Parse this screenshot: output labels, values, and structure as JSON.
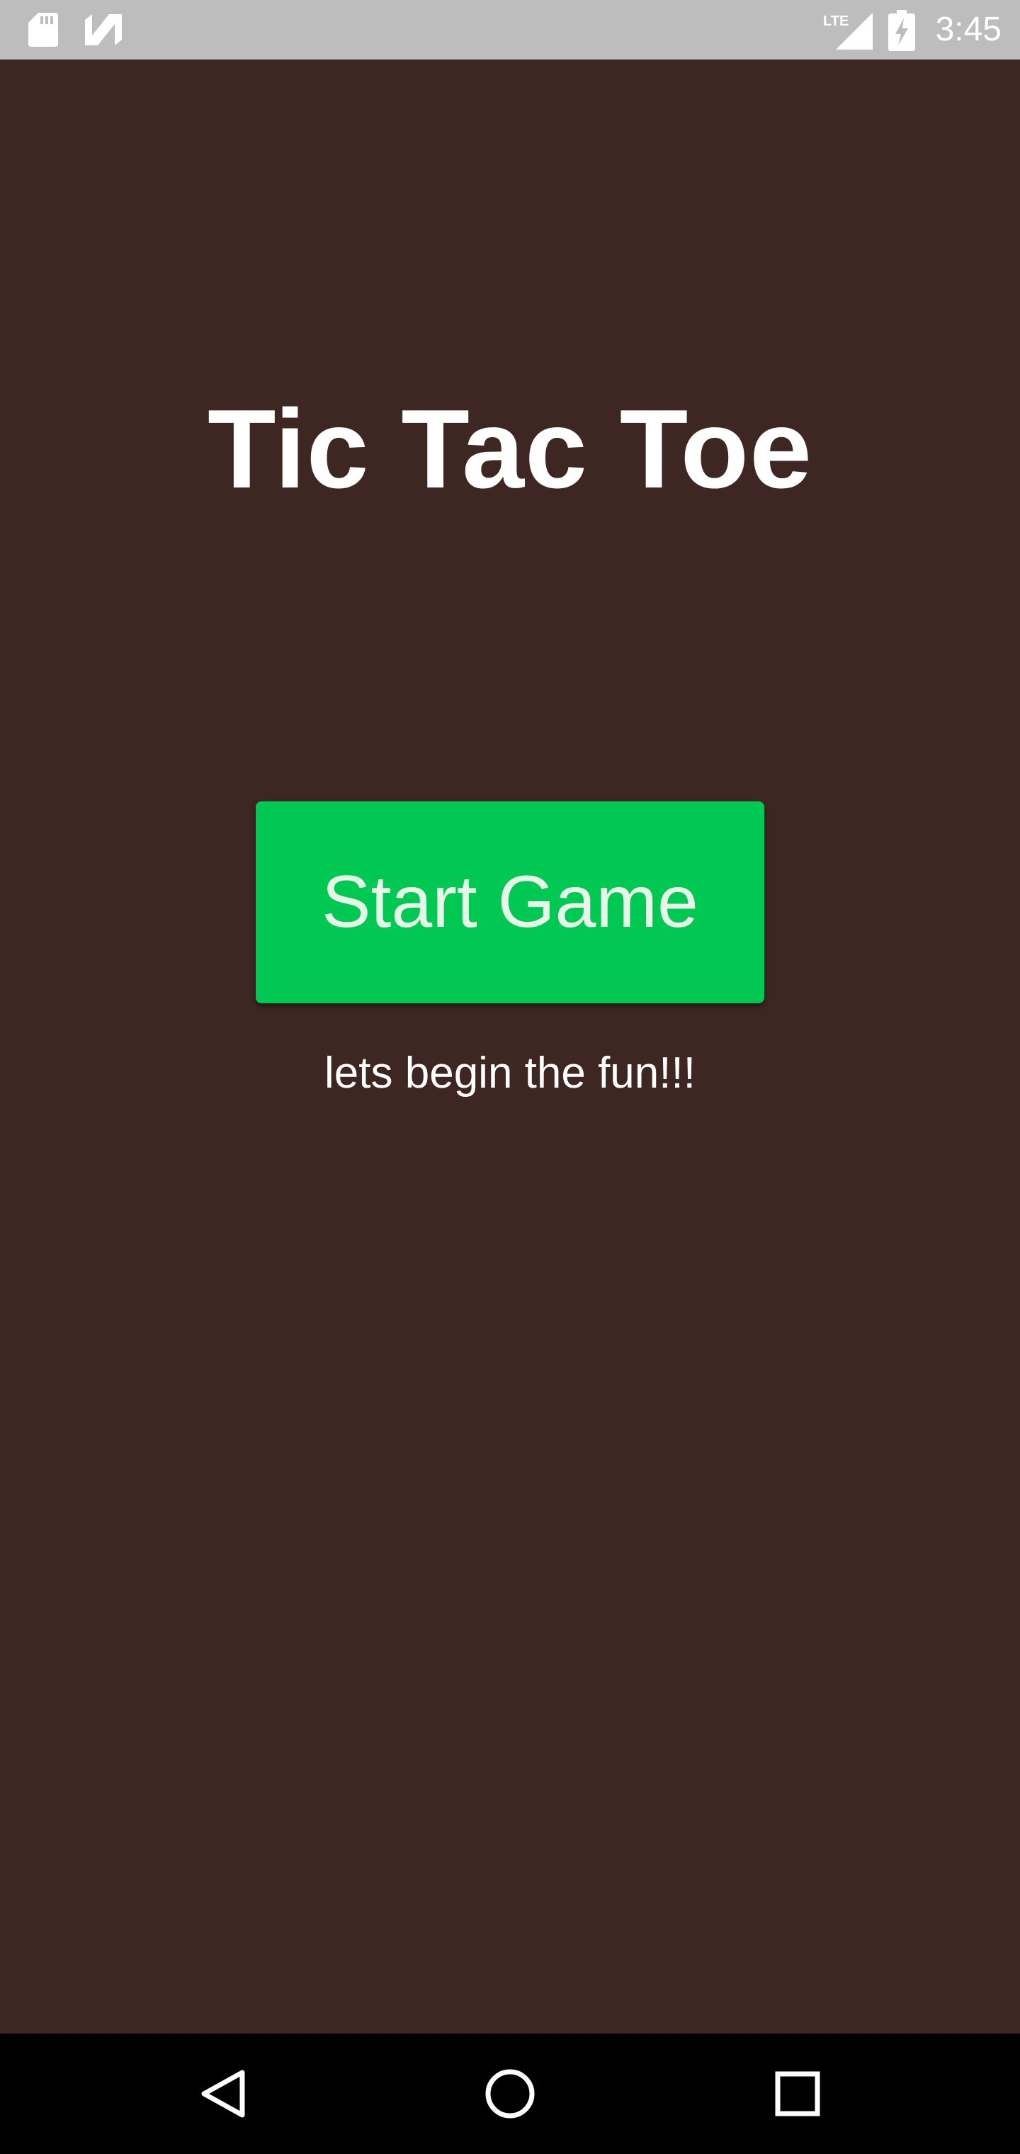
{
  "status_bar": {
    "time": "3:45",
    "left_icons": [
      "sd-card-icon",
      "n-logo-icon"
    ],
    "right_icons": [
      "lte-signal-icon",
      "battery-charging-icon"
    ],
    "network_label": "LTE"
  },
  "main": {
    "title": "Tic Tac Toe",
    "start_button_label": "Start Game",
    "subtitle": "lets begin the fun!!!"
  },
  "nav_bar": {
    "buttons": [
      "back-icon",
      "home-icon",
      "recents-icon"
    ]
  },
  "colors": {
    "background": "#3e2723",
    "button": "#00c853",
    "status_bar": "#bdbdbd",
    "nav_bar": "#000000",
    "text": "#ffffff"
  }
}
